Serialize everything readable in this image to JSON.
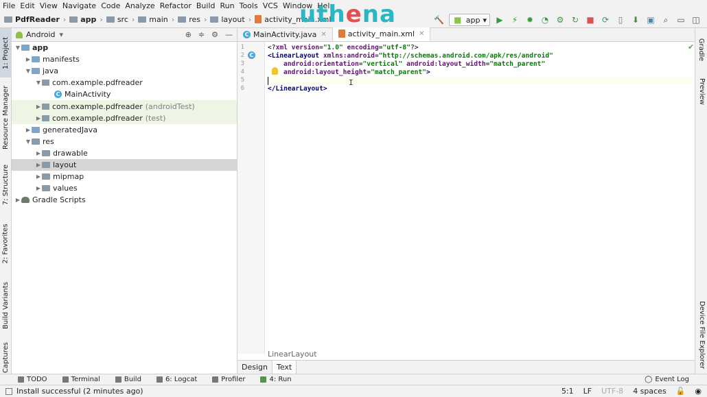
{
  "menu": [
    "File",
    "Edit",
    "View",
    "Navigate",
    "Code",
    "Analyze",
    "Refactor",
    "Build",
    "Run",
    "Tools",
    "VCS",
    "Window",
    "Help"
  ],
  "navbar": {
    "crumbs": [
      "PdfReader",
      "app",
      "src",
      "main",
      "res",
      "layout",
      "activity_main.xml"
    ],
    "run_config": "app"
  },
  "watermark": {
    "part1": "uth",
    "part2": "e",
    "part3": "na"
  },
  "left_tool_tabs": [
    "1: Project",
    "Resource Manager",
    "7: Structure",
    "2: Favorites",
    "Build Variants",
    "Captures"
  ],
  "right_tool_tabs": [
    "Gradle",
    "Preview",
    "Device File Explorer"
  ],
  "project": {
    "view_mode": "Android",
    "tree": [
      {
        "label": "app",
        "depth": 0,
        "expanded": true,
        "icon": "folder-icon"
      },
      {
        "label": "manifests",
        "depth": 1,
        "expanded": false,
        "icon": "folder-icon"
      },
      {
        "label": "java",
        "depth": 1,
        "expanded": true,
        "icon": "folder-icon"
      },
      {
        "label": "com.example.pdfreader",
        "depth": 2,
        "expanded": true,
        "icon": "package-icon"
      },
      {
        "label": "MainActivity",
        "depth": 3,
        "icon": "class-icon"
      },
      {
        "label": "com.example.pdfreader",
        "suffix": "(androidTest)",
        "depth": 2,
        "expanded": false,
        "icon": "package-icon",
        "highlight": true
      },
      {
        "label": "com.example.pdfreader",
        "suffix": "(test)",
        "depth": 2,
        "expanded": false,
        "icon": "package-icon",
        "highlight": true
      },
      {
        "label": "generatedJava",
        "depth": 1,
        "expanded": false,
        "icon": "folder-icon"
      },
      {
        "label": "res",
        "depth": 1,
        "expanded": true,
        "icon": "folder-icon"
      },
      {
        "label": "drawable",
        "depth": 2,
        "expanded": false,
        "icon": "folder-icon"
      },
      {
        "label": "layout",
        "depth": 2,
        "expanded": false,
        "icon": "folder-icon",
        "selected": true
      },
      {
        "label": "mipmap",
        "depth": 2,
        "expanded": false,
        "icon": "folder-icon"
      },
      {
        "label": "values",
        "depth": 2,
        "expanded": false,
        "icon": "folder-icon"
      },
      {
        "label": "Gradle Scripts",
        "depth": 0,
        "expanded": false,
        "icon": "gradle-icon"
      }
    ]
  },
  "editor": {
    "tabs": [
      {
        "label": "MainActivity.java",
        "active": false
      },
      {
        "label": "activity_main.xml",
        "active": true
      }
    ],
    "line_numbers": [
      "1",
      "2",
      "3",
      "4",
      "5",
      "6"
    ],
    "lines": {
      "l1": {
        "a": "<?",
        "b": "xml version",
        "c": "=",
        "d": "\"1.0\"",
        "e": " encoding",
        "f": "=",
        "g": "\"utf-8\"",
        "h": "?>"
      },
      "l2": {
        "a": "<LinearLayout ",
        "b": "xmlns:",
        "c": "android",
        "d": "=",
        "e": "\"http://schemas.android.com/apk/res/android\""
      },
      "l3": {
        "a": "android:orientation",
        "b": "=",
        "c": "\"vertical\"",
        "d": " android:layout_width",
        "e": "=",
        "f": "\"match_parent\""
      },
      "l4": {
        "a": "android:layout_height",
        "b": "=",
        "c": "\"match_parent\"",
        "d": ">"
      },
      "l6": {
        "a": "</LinearLayout>"
      }
    },
    "breadcrumb": "LinearLayout",
    "bottom_tabs": [
      {
        "label": "Design",
        "active": false
      },
      {
        "label": "Text",
        "active": true
      }
    ]
  },
  "tool_windows": [
    "TODO",
    "Terminal",
    "Build",
    "6: Logcat",
    "Profiler",
    "4: Run"
  ],
  "event_log": "Event Log",
  "status": {
    "message": "Install successful (2 minutes ago)",
    "position": "5:1",
    "line_sep": "LF",
    "encoding": "UTF-8",
    "indent": "4 spaces"
  }
}
